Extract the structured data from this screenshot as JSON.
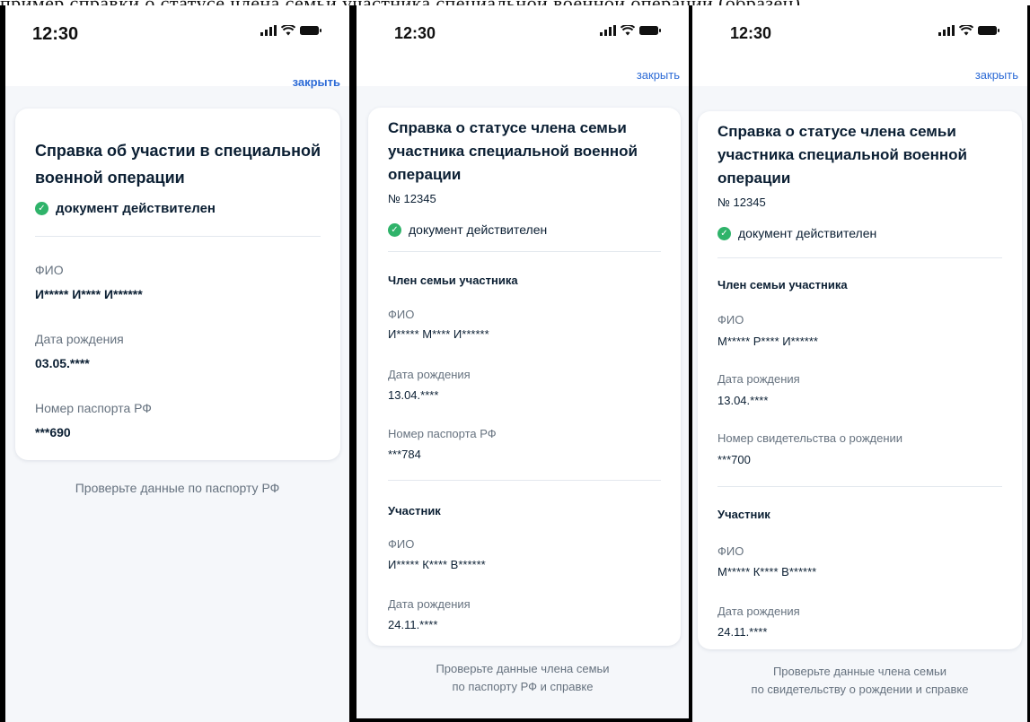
{
  "page": {
    "caption_fragment": "пример справки о статусе члена семьи участника специальной военной операции (образец)"
  },
  "status": {
    "time": "12:30"
  },
  "close_label": "закрыть",
  "screens": [
    {
      "title": "Справка об участии в специальной военной операции",
      "validity": "документ действителен",
      "fields": [
        {
          "label": "ФИО",
          "value": "И***** И**** И******"
        },
        {
          "label": "Дата рождения",
          "value": "03.05.****"
        },
        {
          "label": "Номер паспорта РФ",
          "value": "***690"
        }
      ],
      "hint": "Проверьте данные по паспорту РФ"
    },
    {
      "title": "Справка о статусе члена семьи участника специальной военной операции",
      "number": "№ 12345",
      "validity": "документ действителен",
      "member_section": "Член семьи участника",
      "member_fields": [
        {
          "label": "ФИО",
          "value": "И***** М**** И******"
        },
        {
          "label": "Дата рождения",
          "value": "13.04.****"
        },
        {
          "label": "Номер паспорта РФ",
          "value": "***784"
        }
      ],
      "participant_section": "Участник",
      "participant_fields": [
        {
          "label": "ФИО",
          "value": "И***** К**** В******"
        },
        {
          "label": "Дата рождения",
          "value": "24.11.****"
        }
      ],
      "hint_line1": "Проверьте данные члена семьи",
      "hint_line2": "по паспорту РФ и справке"
    },
    {
      "title": "Справка о статусе члена семьи участника специальной военной операции",
      "number": "№ 12345",
      "validity": "документ действителен",
      "member_section": "Член семьи участника",
      "member_fields": [
        {
          "label": "ФИО",
          "value": "М***** Р**** И******"
        },
        {
          "label": "Дата рождения",
          "value": "13.04.****"
        },
        {
          "label": "Номер свидетельства о рождении",
          "value": "***700"
        }
      ],
      "participant_section": "Участник",
      "participant_fields": [
        {
          "label": "ФИО",
          "value": "М***** К**** В******"
        },
        {
          "label": "Дата рождения",
          "value": "24.11.****"
        }
      ],
      "hint_line1": "Проверьте данные члена семьи",
      "hint_line2": "по свидетельству о рождении и справке"
    }
  ]
}
